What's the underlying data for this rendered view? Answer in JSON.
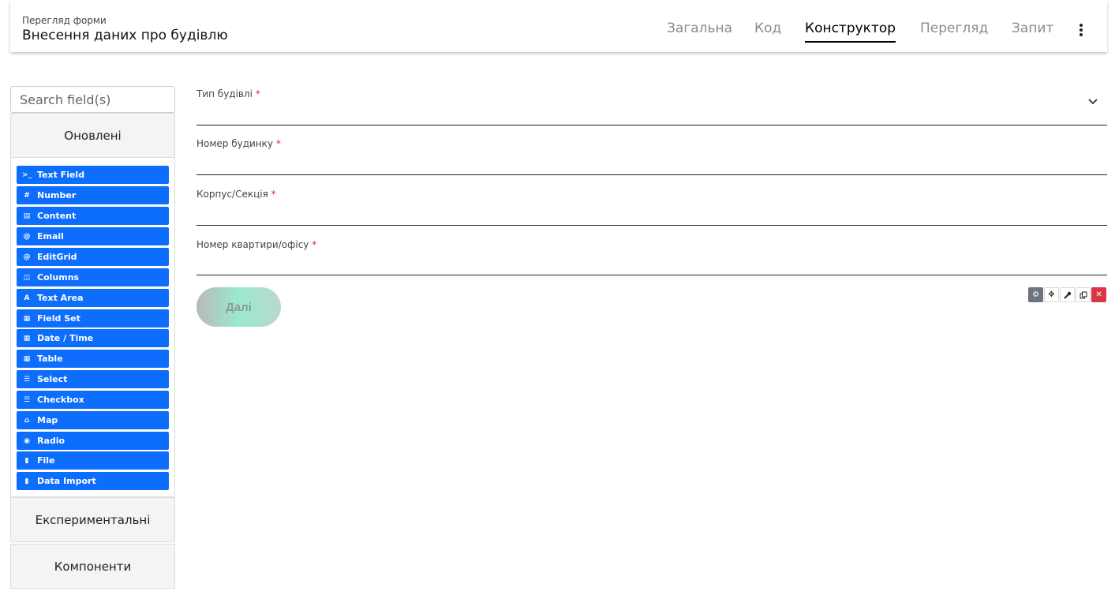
{
  "header": {
    "subtitle": "Перегляд форми",
    "title": "Внесення даних про будівлю",
    "tabs": [
      {
        "label": "Загальна",
        "active": false
      },
      {
        "label": "Код",
        "active": false
      },
      {
        "label": "Конструктор",
        "active": true
      },
      {
        "label": "Перегляд",
        "active": false
      },
      {
        "label": "Запит",
        "active": false
      }
    ],
    "more_icon": "more-vert-icon"
  },
  "sidebar": {
    "search_placeholder": "Search field(s)",
    "groups": [
      "Оновлені",
      "Експериментальні",
      "Компоненти"
    ],
    "components": [
      {
        "label": "Text Field",
        "icon": "terminal-icon",
        "glyph": ">_"
      },
      {
        "label": "Number",
        "icon": "hash-icon",
        "glyph": "#"
      },
      {
        "label": "Content",
        "icon": "html5-icon",
        "glyph": "▤"
      },
      {
        "label": "Email",
        "icon": "at-icon",
        "glyph": "@"
      },
      {
        "label": "EditGrid",
        "icon": "at-icon",
        "glyph": "@"
      },
      {
        "label": "Columns",
        "icon": "columns-icon",
        "glyph": "◫"
      },
      {
        "label": "Text Area",
        "icon": "font-icon",
        "glyph": "A"
      },
      {
        "label": "Field Set",
        "icon": "th-large-icon",
        "glyph": "▦"
      },
      {
        "label": "Date / Time",
        "icon": "calendar-icon",
        "glyph": "▦"
      },
      {
        "label": "Table",
        "icon": "table-icon",
        "glyph": "▦"
      },
      {
        "label": "Select",
        "icon": "list-icon",
        "glyph": "☰"
      },
      {
        "label": "Checkbox",
        "icon": "list-icon",
        "glyph": "☰"
      },
      {
        "label": "Map",
        "icon": "home-icon",
        "glyph": "⌂"
      },
      {
        "label": "Radio",
        "icon": "dot-circle-icon",
        "glyph": "◉"
      },
      {
        "label": "File",
        "icon": "file-icon",
        "glyph": "▮"
      },
      {
        "label": "Data Import",
        "icon": "file-icon",
        "glyph": "▮"
      }
    ],
    "accent": "#0d6efd"
  },
  "form": {
    "fields": [
      {
        "label": "Тип будівлі",
        "required_mark": "*",
        "type": "select"
      },
      {
        "label": "Номер будинку",
        "required_mark": "*",
        "type": "text"
      },
      {
        "label": "Корпус/Секція",
        "required_mark": "*",
        "type": "text"
      },
      {
        "label": "Номер квартири/офісу",
        "required_mark": "*",
        "type": "text"
      }
    ],
    "submit_label": "Далі",
    "toolbar": [
      "gear-icon",
      "move-icon",
      "wrench-icon",
      "copy-icon",
      "close-icon"
    ]
  }
}
